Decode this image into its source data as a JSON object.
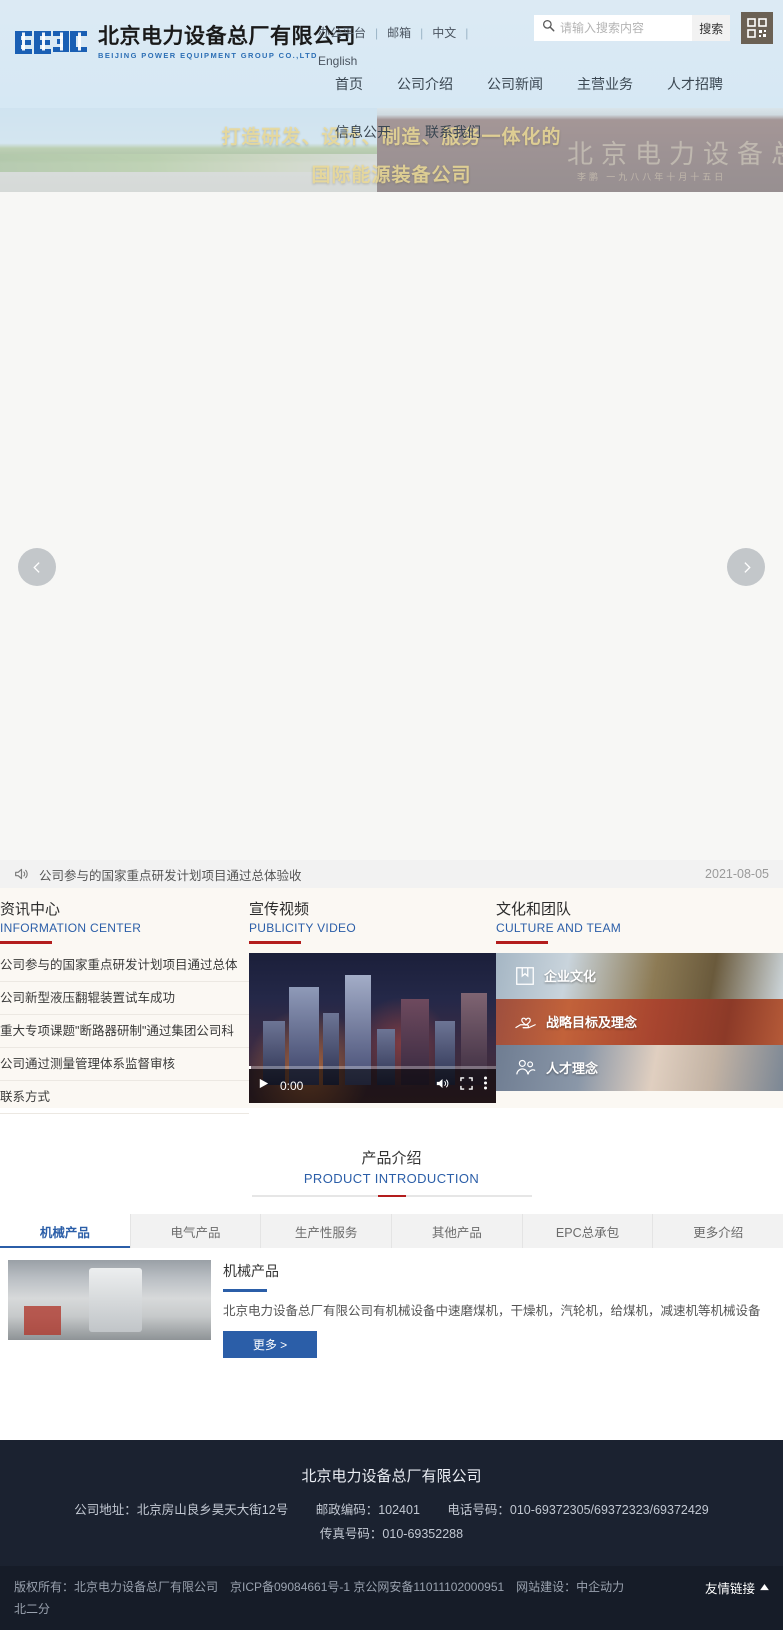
{
  "header": {
    "logo": {
      "mark_alt": "cegc-logo",
      "company_cn": "北京电力设备总厂有限公司",
      "company_en": "BEIJING POWER EQUIPMENT GROUP CO.,LTD"
    },
    "toplinks": [
      {
        "label": "办公平台"
      },
      {
        "label": "邮箱"
      },
      {
        "label": "中文"
      },
      {
        "label": "English"
      }
    ],
    "separator": "|",
    "search": {
      "placeholder": "请输入搜索内容",
      "value": "",
      "button": "搜索"
    },
    "qr_label": "qr-code"
  },
  "nav": {
    "row1": [
      "首页",
      "公司介绍",
      "公司新闻",
      "主营业务",
      "人才招聘"
    ],
    "row2": [
      "信息公开",
      "联系我们"
    ]
  },
  "banner": {
    "caption_line1": "打造研发、设计、制造、服务一体化的",
    "caption_line2": "国际能源装备公司",
    "calligraphy": "北京电力设备总厂",
    "calligraphy_sub": "李鹏 一九八八年十月十五日",
    "prev_label": "上一张",
    "next_label": "下一张"
  },
  "ticker": {
    "text": "公司参与的国家重点研发计划项目通过总体验收",
    "date": "2021-08-05",
    "icon": "speaker-icon"
  },
  "news": {
    "title_cn": "资讯中心",
    "title_en": "INFORMATION CENTER",
    "items": [
      "公司参与的国家重点研发计划项目通过总体",
      "公司新型液压翻辊装置试车成功",
      "重大专项课题\"断路器研制\"通过集团公司科",
      "公司通过测量管理体系监督审核",
      "联系方式"
    ]
  },
  "video": {
    "title_cn": "宣传视频",
    "title_en": "PUBLICITY VIDEO",
    "time": "0:00",
    "play_label": "播放",
    "mute_label": "静音",
    "fullscreen_label": "全屏",
    "menu_label": "更多选项"
  },
  "culture": {
    "title_cn": "文化和团队",
    "title_en": "CULTURE AND TEAM",
    "items": [
      {
        "label": "企业文化",
        "icon": "book-icon"
      },
      {
        "label": "战略目标及理念",
        "icon": "heart-hand-icon"
      },
      {
        "label": "人才理念",
        "icon": "people-icon"
      }
    ]
  },
  "product": {
    "title_cn": "产品介绍",
    "title_en": "PRODUCT INTRODUCTION",
    "tabs": [
      {
        "label": "机械产品",
        "active": true
      },
      {
        "label": "电气产品",
        "active": false
      },
      {
        "label": "生产性服务",
        "active": false
      },
      {
        "label": "其他产品",
        "active": false
      },
      {
        "label": "EPC总承包",
        "active": false
      },
      {
        "label": "更多介绍",
        "active": false
      }
    ],
    "panel": {
      "heading": "机械产品",
      "description": "北京电力设备总厂有限公司有机械设备中速磨煤机，干燥机，汽轮机，给煤机，减速机等机械设备",
      "more_label": "更多 >"
    }
  },
  "footer": {
    "company": "北京电力设备总厂有限公司",
    "address_label": "公司地址：北京房山良乡昊天大街12号",
    "zip_label": "邮政编码：102401",
    "phone_label": "电话号码：010-69372305/69372323/69372429",
    "fax_label": "传真号码：010-69352288",
    "copyright": "版权所有：北京电力设备总厂有限公司　京ICP备09084661号-1 京公网安备11011102000951　网站建设：中企动力 北二分",
    "links_label": "友情链接"
  },
  "colors": {
    "brand_blue": "#2b5ea8",
    "accent_red": "#b31d1d",
    "header_bg": "#d8eaf5",
    "footer_bg": "#1b2230"
  }
}
